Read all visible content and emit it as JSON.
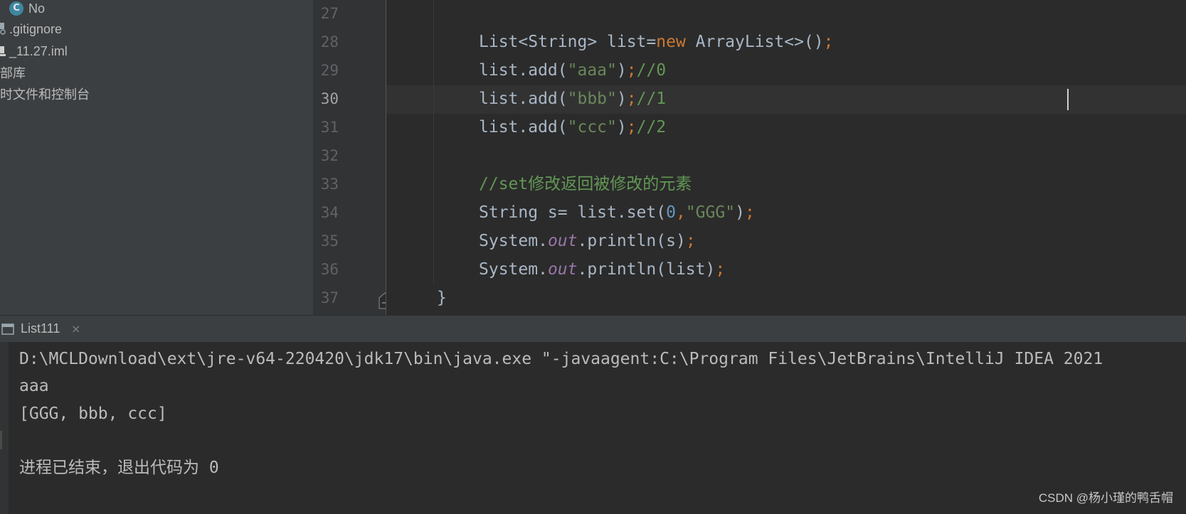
{
  "project_tree": {
    "items": [
      {
        "label": "No"
      },
      {
        "label": ".gitignore"
      },
      {
        "label": "_11.27.iml"
      },
      {
        "label": "部库"
      },
      {
        "label": "时文件和控制台"
      }
    ]
  },
  "editor": {
    "current_line": "30",
    "lines": [
      {
        "number": "27"
      },
      {
        "number": "28",
        "tokens": [
          "List<String> list=",
          "new",
          " ArrayList<>()",
          ";"
        ]
      },
      {
        "number": "29",
        "tokens": [
          "list.add(",
          "\"aaa\"",
          ")",
          ";",
          "//0"
        ]
      },
      {
        "number": "30",
        "tokens": [
          "list.add(",
          "\"bbb\"",
          ")",
          ";",
          "//1"
        ]
      },
      {
        "number": "31",
        "tokens": [
          "list.add(",
          "\"ccc\"",
          ")",
          ";",
          "//2"
        ]
      },
      {
        "number": "32"
      },
      {
        "number": "33",
        "tokens": [
          "//set修改返回被修改的元素"
        ]
      },
      {
        "number": "34",
        "tokens": [
          "String s= list.set(",
          "0",
          ",",
          "\"GGG\"",
          ")",
          ";"
        ]
      },
      {
        "number": "35",
        "tokens": [
          "System.",
          "out",
          ".println(s)",
          ";"
        ]
      },
      {
        "number": "36",
        "tokens": [
          "System.",
          "out",
          ".println(list)",
          ";"
        ]
      },
      {
        "number": "37",
        "tokens": [
          "}"
        ]
      }
    ]
  },
  "run_panel": {
    "tab_label": "List111",
    "close_glyph": "×",
    "console_lines": [
      "D:\\MCLDownload\\ext\\jre-v64-220420\\jdk17\\bin\\java.exe \"-javaagent:C:\\Program Files\\JetBrains\\IntelliJ IDEA 2021",
      "aaa",
      "[GGG, bbb, ccc]",
      "",
      "进程已结束，退出代码为 0"
    ]
  },
  "watermark": "CSDN @杨小瑾的鸭舌帽",
  "icons": {
    "class_icon_letter": "C",
    "class_icon": "java-class-icon",
    "file_icon": "file-icon",
    "intention_icon": "lightbulb-icon",
    "fold_icon": "fold-marker-icon",
    "run_tab_icon": "console-icon"
  },
  "colors": {
    "keyword": "#cc7832",
    "string": "#6a8759",
    "number": "#6897bb",
    "comment": "#629755",
    "static_field": "#9876aa",
    "default_text": "#a9b7c6",
    "background": "#2b2b2b"
  }
}
